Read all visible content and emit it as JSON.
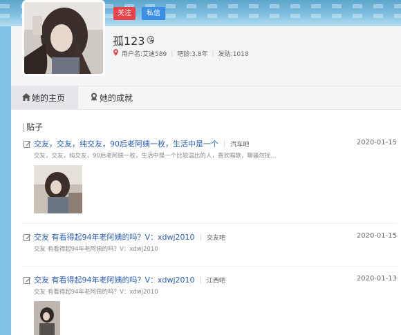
{
  "profile": {
    "follow_label": "关注",
    "message_label": "私信",
    "username": "孤123",
    "emoji": "😘",
    "login_name": "用户名:艾迪589",
    "forum_age": "吧龄:3.8年",
    "post_count": "发贴:1018"
  },
  "tabs": [
    {
      "label": "她的主页"
    },
    {
      "label": "她的成就"
    }
  ],
  "section_title": "贴子",
  "posts": [
    {
      "title": "交友，交友，纯交友，90后老阿姨一枚，生活中是一个",
      "forum": "汽车吧",
      "date": "2020-01-15",
      "summary": "交友，交友，纯交友，90后老阿姨一枚，生活中是一个比较温比的人，喜欢唱歌，聊骚勿扰..."
    },
    {
      "title": "交友 有看得起94年老阿姨的吗？V：xdwj2010",
      "forum": "交友吧",
      "date": "2020-01-15",
      "summary": "交友 有看得起94年老阿姨的吗？V：xdwj2010"
    },
    {
      "title": "交友 有看得起94年老阿姨的吗？V：xdwj2010",
      "forum": "江西吧",
      "date": "2020-01-13",
      "summary": "交友 有看得起94年老阿姨的吗？V：xdwj2010"
    }
  ],
  "colors": {
    "link": "#2a5db0",
    "follow": "#e8434a",
    "message": "#3b8ee4"
  }
}
